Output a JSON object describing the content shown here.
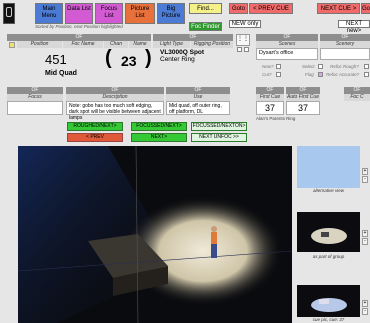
{
  "nav": {
    "main": "Main Menu",
    "data": "Data List",
    "focus": "Focus List",
    "picture": "Picture List",
    "big": "Big Picture",
    "find": "Find...",
    "foc_finder": "Foc Finder",
    "goto": "Goto",
    "prev_cue": "< PREV CUE",
    "next_cue": "NEXT CUE >",
    "goto_right": "Goto",
    "new_only": "NEW only",
    "next_new": "NEXT new>",
    "sorted_text": "Sorted by Position, next Position highlighted"
  },
  "headers": {
    "position": "Position",
    "foc_name": "Foc Name",
    "chan": "Chan",
    "name": "Name",
    "light_type": "Light Type",
    "rigging": "Rigging Position",
    "scenes": "Scenes",
    "scenery": "Scenery",
    "focus": "Focus",
    "description": "Description",
    "use": "Use",
    "first_cue": "First Cue",
    "auto_first_cue": "Auto First Cue",
    "foc_c": "Foc C"
  },
  "record": {
    "position_num": "451",
    "position_name": "Mid Quad",
    "chan": "23",
    "light_type": "VL3000Q Spot",
    "rigging": "Center Ring",
    "scenes": "Dysart's office",
    "first_cue": "37",
    "auto_first_cue": "37",
    "first_cue_label": "Alan's Parents Ring",
    "description": "Note: gobo has too much soft edging, dark spot will be visible between adjacent lamps",
    "use": "Mid quad, off outer ring, off platform, DL"
  },
  "checks": {
    "new": "New?",
    "cut": "Cut?",
    "select": "Select",
    "flag": "Flag",
    "refoc_rough": "Refoc Rough?",
    "refoc_accurate": "Refoc Accurate?"
  },
  "buttons": {
    "roughed": "ROUGHED/NEXT>",
    "focussed": "FOCUSSED/NEXT>",
    "focussed_nexton": "FOCUSSED/NEXTON>",
    "prev": "< PREV",
    "next": "NEXT>",
    "next_unfoc": "NEXT UNFOC >>"
  },
  "captions": {
    "alt": "alternative view",
    "group": "as part of group",
    "cue": "cue pic, cue: 37"
  },
  "colors": {
    "main": "#4b7bd4",
    "data": "#d25ad2",
    "focus": "#d25ad2",
    "picture": "#e8703a",
    "big": "#4b7bd4",
    "find": "#f4f08a",
    "foc_finder": "#2e9a2e",
    "goto": "#f06a6a",
    "green": "#35c935",
    "red": "#e05a3a"
  }
}
